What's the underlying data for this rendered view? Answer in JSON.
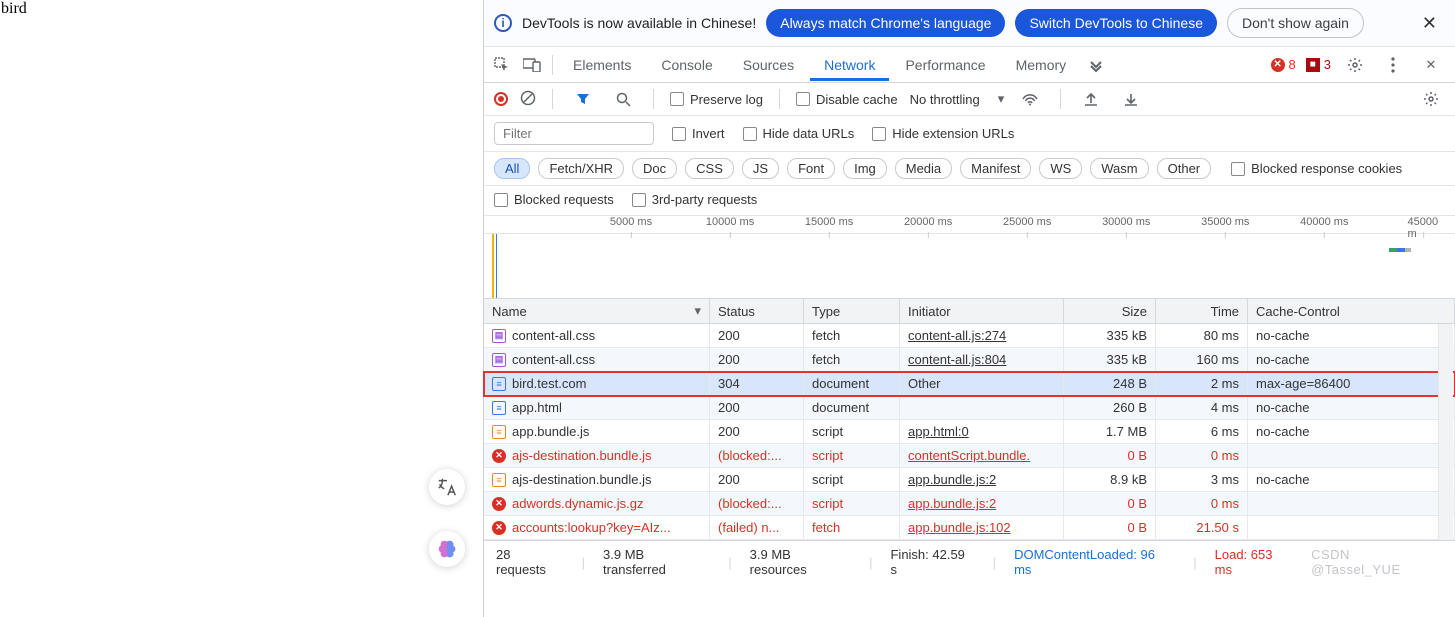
{
  "page": {
    "body_text": "bird"
  },
  "infobar": {
    "text": "DevTools is now available in Chinese!",
    "btn_match": "Always match Chrome's language",
    "btn_switch": "Switch DevTools to Chinese",
    "btn_dismiss": "Don't show again"
  },
  "tabs": {
    "items": [
      "Elements",
      "Console",
      "Sources",
      "Network",
      "Performance",
      "Memory"
    ],
    "active_index": 3,
    "errors_count": "8",
    "issues_count": "3"
  },
  "toolbar": {
    "preserve_label": "Preserve log",
    "disable_cache_label": "Disable cache",
    "throttling": "No throttling"
  },
  "filter": {
    "placeholder": "Filter",
    "invert": "Invert",
    "hide_data": "Hide data URLs",
    "hide_ext": "Hide extension URLs"
  },
  "type_filters": [
    "All",
    "Fetch/XHR",
    "Doc",
    "CSS",
    "JS",
    "Font",
    "Img",
    "Media",
    "Manifest",
    "WS",
    "Wasm",
    "Other"
  ],
  "blocked_cookies": "Blocked response cookies",
  "extra": {
    "blocked_req": "Blocked requests",
    "third_party": "3rd-party requests"
  },
  "timeline_ticks": [
    "5000 ms",
    "10000 ms",
    "15000 ms",
    "20000 ms",
    "25000 ms",
    "30000 ms",
    "35000 ms",
    "40000 ms",
    "45000 m"
  ],
  "columns": {
    "name": "Name",
    "status": "Status",
    "type": "Type",
    "initiator": "Initiator",
    "size": "Size",
    "time": "Time",
    "cache": "Cache-Control"
  },
  "rows": [
    {
      "icon": "css",
      "name": "content-all.css",
      "status": "200",
      "type": "fetch",
      "initiator": "content-all.js:274",
      "size": "335 kB",
      "time": "80 ms",
      "cache": "no-cache"
    },
    {
      "icon": "css",
      "name": "content-all.css",
      "status": "200",
      "type": "fetch",
      "initiator": "content-all.js:804",
      "size": "335 kB",
      "time": "160 ms",
      "cache": "no-cache"
    },
    {
      "icon": "doc",
      "name": "bird.test.com",
      "status": "304",
      "type": "document",
      "initiator": "Other",
      "initiator_plain": true,
      "size": "248 B",
      "time": "2 ms",
      "cache": "max-age=86400",
      "selected": true,
      "highlight": true
    },
    {
      "icon": "doc",
      "name": "app.html",
      "status": "200",
      "type": "document",
      "initiator": "",
      "size": "260 B",
      "time": "4 ms",
      "cache": "no-cache"
    },
    {
      "icon": "js",
      "name": "app.bundle.js",
      "status": "200",
      "type": "script",
      "initiator": "app.html:0",
      "size": "1.7 MB",
      "time": "6 ms",
      "cache": "no-cache"
    },
    {
      "icon": "err",
      "name": "ajs-destination.bundle.js",
      "status": "(blocked:...",
      "type": "script",
      "initiator": "contentScript.bundle.",
      "init_err": true,
      "size": "0 B",
      "time": "0 ms",
      "cache": "",
      "error": true
    },
    {
      "icon": "js",
      "name": "ajs-destination.bundle.js",
      "status": "200",
      "type": "script",
      "initiator": "app.bundle.js:2",
      "size": "8.9 kB",
      "time": "3 ms",
      "cache": "no-cache"
    },
    {
      "icon": "err",
      "name": "adwords.dynamic.js.gz",
      "status": "(blocked:...",
      "type": "script",
      "initiator": "app.bundle.js:2",
      "init_err": true,
      "size": "0 B",
      "time": "0 ms",
      "cache": "",
      "error": true
    },
    {
      "icon": "err",
      "name": "accounts:lookup?key=AIz...",
      "status": "(failed) n...",
      "type": "fetch",
      "initiator": "app.bundle.js:102",
      "init_err": true,
      "size": "0 B",
      "time": "21.50 s",
      "cache": "",
      "error": true
    }
  ],
  "statusbar": {
    "requests": "28 requests",
    "transferred": "3.9 MB transferred",
    "resources": "3.9 MB resources",
    "finish": "Finish: 42.59 s",
    "dom": "DOMContentLoaded: 96 ms",
    "load": "Load: 653 ms",
    "watermark": "CSDN @Tassel_YUE"
  }
}
